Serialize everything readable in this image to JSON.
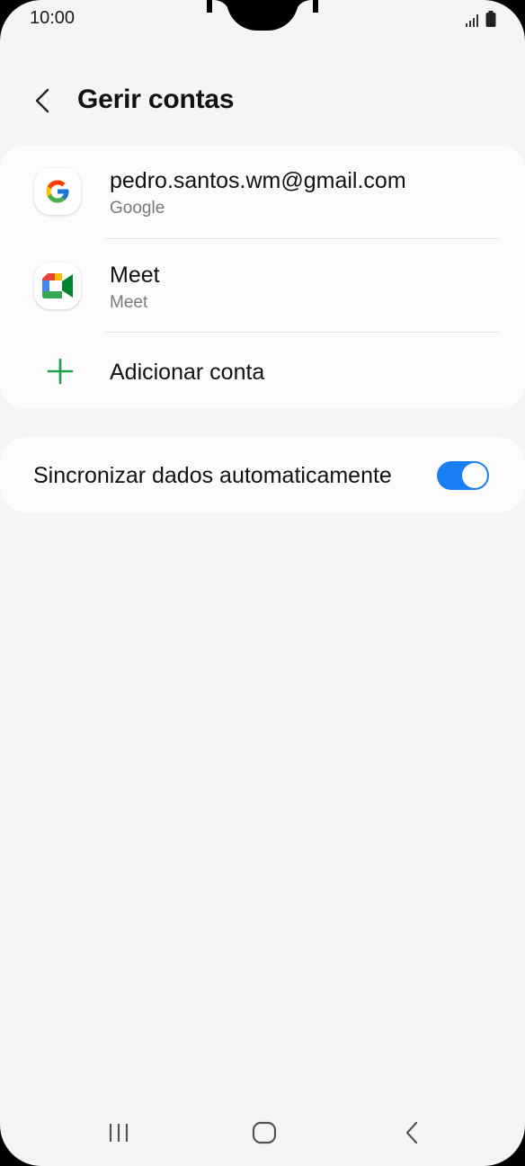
{
  "status_bar": {
    "time": "10:00",
    "signal_icon": "signal-icon",
    "battery_icon": "battery-icon"
  },
  "header": {
    "title": "Gerir contas",
    "back_icon": "chevron-left-icon"
  },
  "accounts": [
    {
      "name": "pedro.santos.wm@gmail.com",
      "type": "Google",
      "icon": "google-icon"
    },
    {
      "name": "Meet",
      "type": "Meet",
      "icon": "meet-icon"
    }
  ],
  "add_account": {
    "label": "Adicionar conta",
    "icon": "plus-icon"
  },
  "auto_sync": {
    "label": "Sincronizar dados automaticamente",
    "enabled": true
  },
  "nav_bar": {
    "recents_icon": "recents-icon",
    "home_icon": "home-icon",
    "back_icon": "back-icon"
  },
  "colors": {
    "background": "#f5f5f5",
    "card": "#fcfcfc",
    "accent": "#1a7ef5",
    "add_green": "#1a9e4a"
  }
}
